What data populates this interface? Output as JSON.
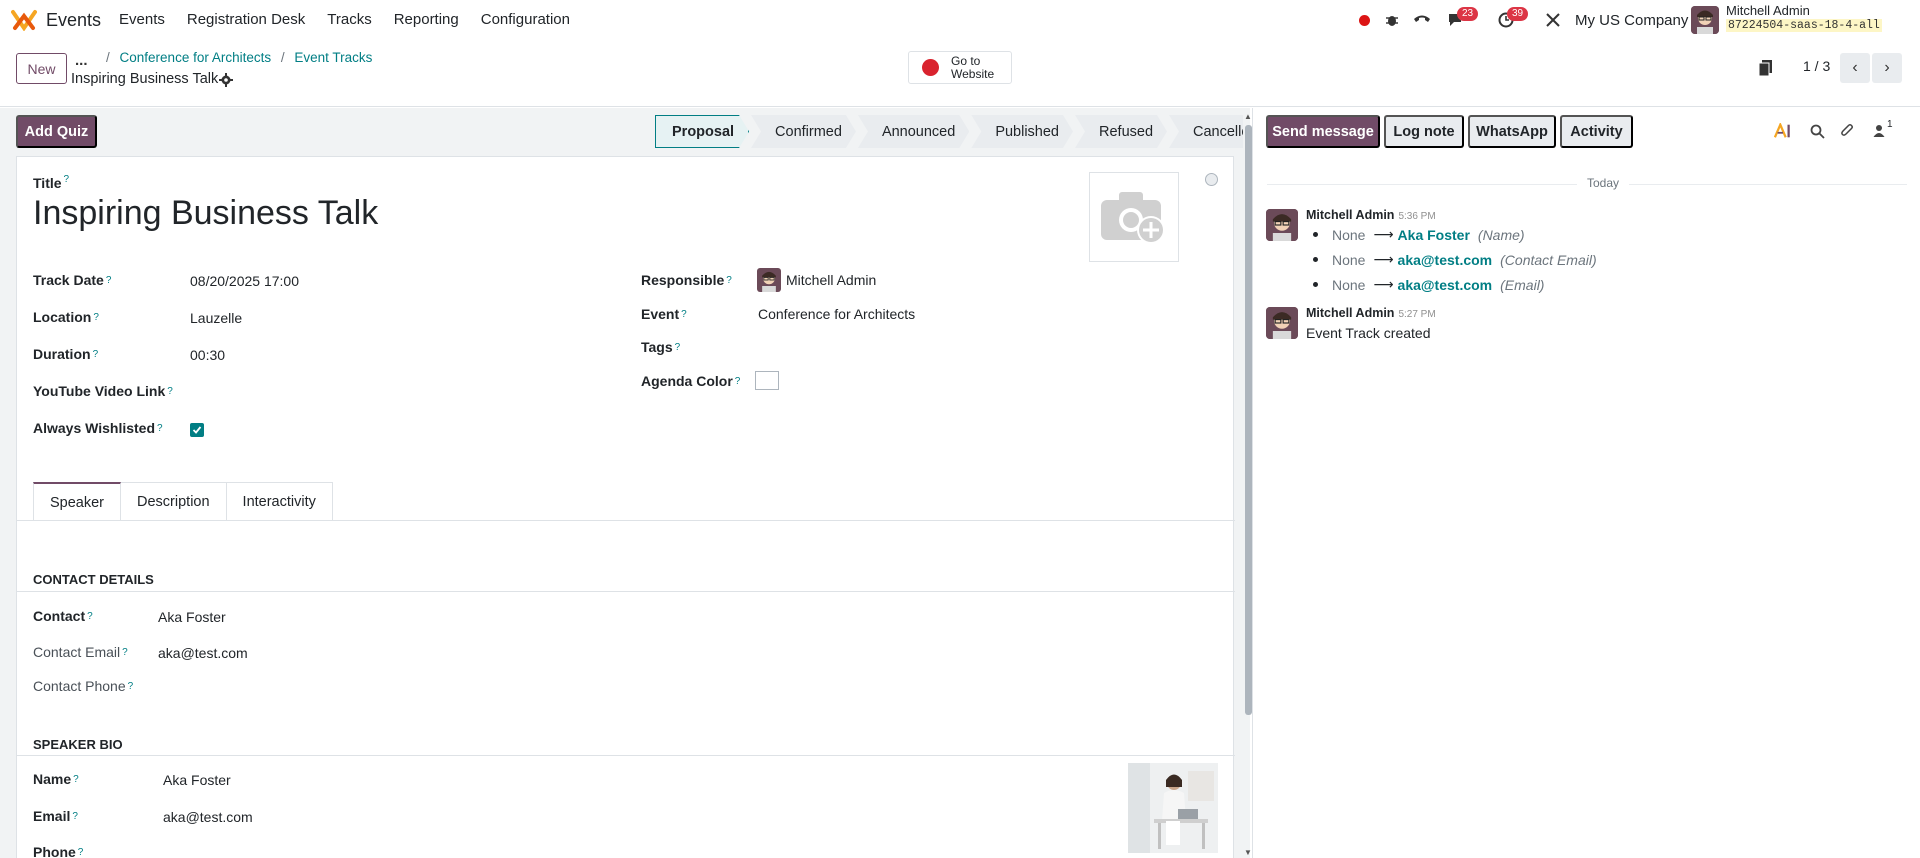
{
  "navbar": {
    "app_name": "Events",
    "menu": [
      "Events",
      "Registration Desk",
      "Tracks",
      "Reporting",
      "Configuration"
    ],
    "badges": {
      "messages": "23",
      "activities": "39"
    },
    "company": "My US Company",
    "user_name": "Mitchell Admin",
    "db_name": "87224504-saas-18-4-all"
  },
  "control_panel": {
    "new_label": "New",
    "more_label": "...",
    "breadcrumbs": [
      "Conference for Architects",
      "Event Tracks"
    ],
    "record_title": "Inspiring Business Talk",
    "goto_website": [
      "Go to",
      "Website"
    ],
    "pager": "1 / 3"
  },
  "form": {
    "add_quiz_label": "Add Quiz",
    "stages": [
      "Proposal",
      "Confirmed",
      "Announced",
      "Published",
      "Refused",
      "Cancelled"
    ],
    "active_stage": "Proposal",
    "title_label": "Title",
    "title_value": "Inspiring Business Talk",
    "left_fields": {
      "track_date_label": "Track Date",
      "track_date_value": "08/20/2025 17:00",
      "location_label": "Location",
      "location_value": "Lauzelle",
      "duration_label": "Duration",
      "duration_value": "00:30",
      "youtube_label": "YouTube Video Link",
      "wishlisted_label": "Always Wishlisted"
    },
    "right_fields": {
      "responsible_label": "Responsible",
      "responsible_value": "Mitchell Admin",
      "event_label": "Event",
      "event_value": "Conference for Architects",
      "tags_label": "Tags",
      "agenda_color_label": "Agenda Color"
    },
    "tabs": [
      "Speaker",
      "Description",
      "Interactivity"
    ],
    "contact_section": {
      "header": "CONTACT DETAILS",
      "contact_label": "Contact",
      "contact_value": "Aka Foster",
      "email_label": "Contact Email",
      "email_value": "aka@test.com",
      "phone_label": "Contact Phone"
    },
    "speaker_section": {
      "header": "SPEAKER BIO",
      "name_label": "Name",
      "name_value": "Aka Foster",
      "email_label": "Email",
      "email_value": "aka@test.com",
      "phone_label": "Phone"
    }
  },
  "chatter": {
    "send_message": "Send message",
    "log_note": "Log note",
    "whatsapp": "WhatsApp",
    "activity": "Activity",
    "followers_count": "1",
    "date_separator": "Today",
    "messages": [
      {
        "author": "Mitchell Admin",
        "time": "5:36 PM",
        "changes": [
          {
            "old": "None",
            "new": "Aka Foster",
            "field": "(Name)"
          },
          {
            "old": "None",
            "new": "aka@test.com",
            "field": "(Contact Email)"
          },
          {
            "old": "None",
            "new": "aka@test.com",
            "field": "(Email)"
          }
        ]
      },
      {
        "author": "Mitchell Admin",
        "time": "5:27 PM",
        "body": "Event Track created"
      }
    ]
  },
  "colors": {
    "brand": "#714b67",
    "accent": "#017e84",
    "badge": "#dc3545"
  }
}
